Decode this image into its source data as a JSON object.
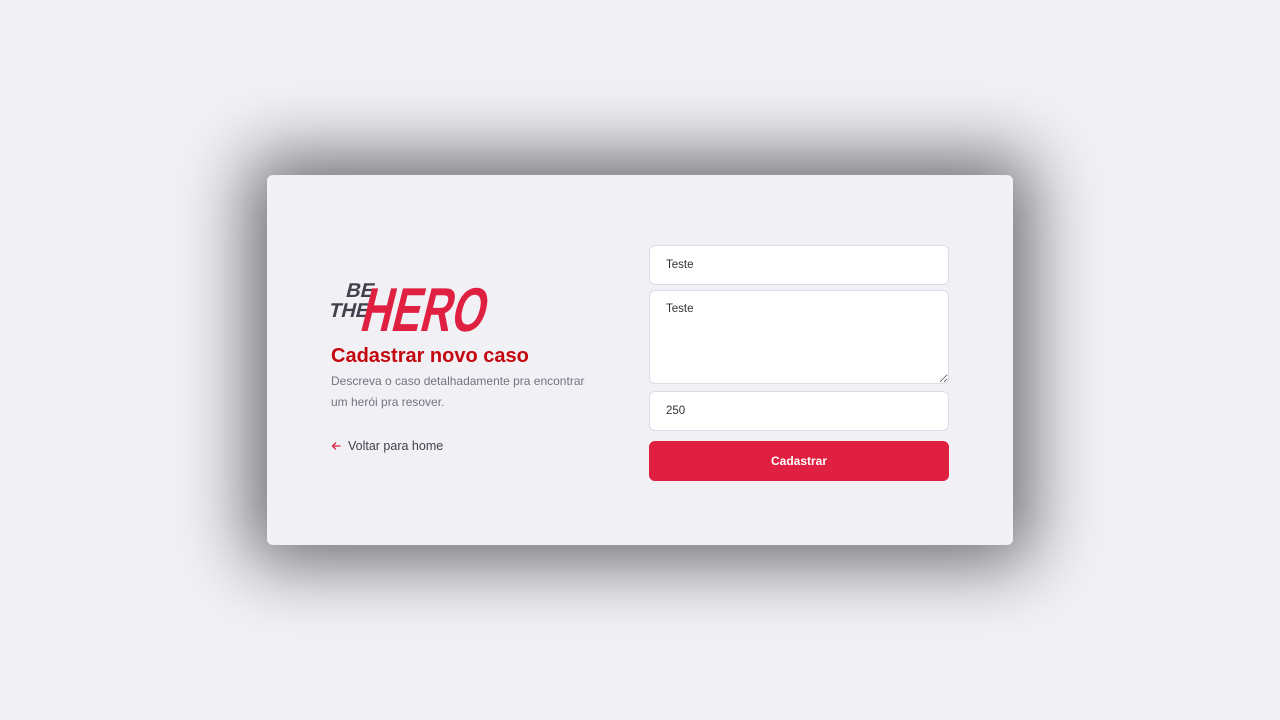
{
  "logo": {
    "line1": "BE",
    "line2": "THE",
    "line3": "HERO"
  },
  "page": {
    "title": "Cadastrar novo caso",
    "description": "Descreva o caso detalhadamente pra encontrar um herói pra resover.",
    "back_link": "Voltar para home",
    "back_icon": "arrow-left-icon"
  },
  "form": {
    "title_value": "Teste",
    "description_value": "Teste",
    "value_value": "250",
    "submit_label": "Cadastrar"
  },
  "colors": {
    "accent": "#e02041",
    "title": "#c4070f",
    "background": "#f0f0f5"
  }
}
